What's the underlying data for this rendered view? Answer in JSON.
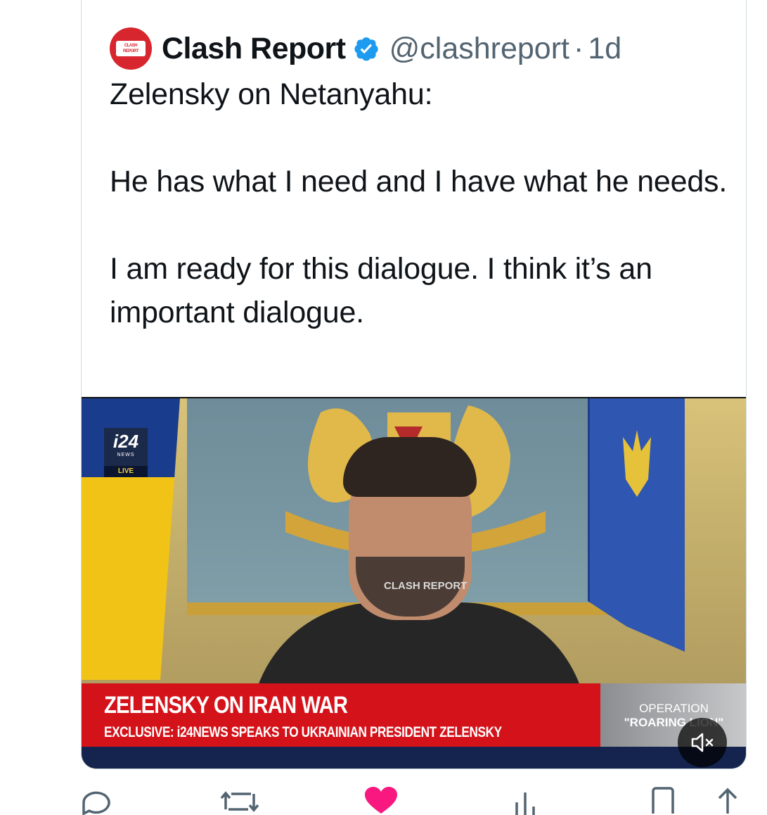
{
  "tweet": {
    "author_name": "Clash Report",
    "avatar_text": "CLASH REPORT",
    "handle": "@clashreport",
    "separator": "·",
    "time_ago": "1d",
    "text": "Zelensky on Netanyahu:\n\nHe has what I need and I have what he needs.\n\nI am ready for this dialogue. I think it’s an important dialogue."
  },
  "video": {
    "channel_logo": "i24",
    "channel_sub": "NEWS",
    "live_label": "LIVE",
    "watermark": "CLASH REPORT",
    "headline": "ZELENSKY ON IRAN WAR",
    "subheadline": "EXCLUSIVE: i24NEWS SPEAKS TO UKRAINIAN PRESIDENT ZELENSKY",
    "operation_line1": "OPERATION",
    "operation_line2": "\"ROARING LION\"",
    "mute_icon": "speaker-muted-icon"
  },
  "actions": {
    "reply_icon": "reply-icon",
    "retweet_icon": "retweet-icon",
    "like_icon": "heart-icon",
    "views_icon": "views-icon",
    "bookmark_icon": "bookmark-icon",
    "share_icon": "share-icon"
  },
  "colors": {
    "text": "#0f1419",
    "muted": "#536471",
    "verified": "#1d9bf0",
    "like": "#f91880",
    "banner_red": "#d4121a"
  }
}
